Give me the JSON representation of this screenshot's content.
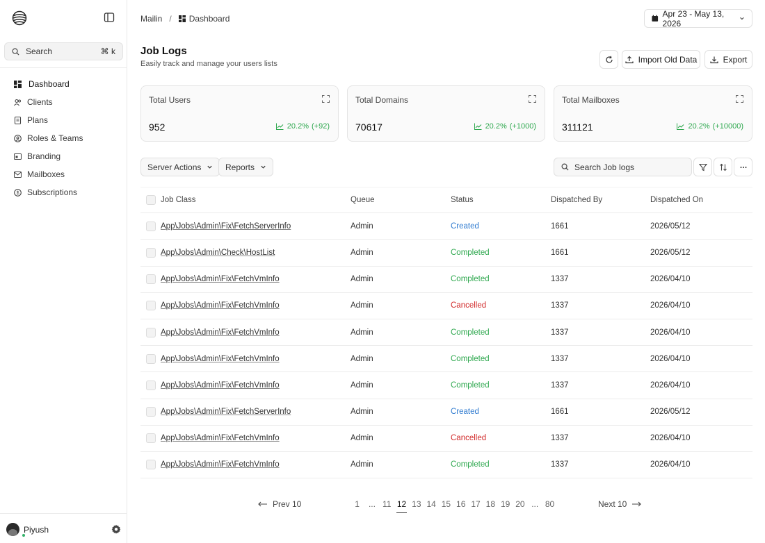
{
  "sidebar": {
    "search_label": "Search",
    "search_shortcut": "⌘ k",
    "items": [
      {
        "label": "Dashboard",
        "icon": "dashboard-icon"
      },
      {
        "label": "Clients",
        "icon": "users-icon"
      },
      {
        "label": "Plans",
        "icon": "document-icon"
      },
      {
        "label": "Roles & Teams",
        "icon": "roles-icon"
      },
      {
        "label": "Branding",
        "icon": "branding-icon"
      },
      {
        "label": "Mailboxes",
        "icon": "mail-icon"
      },
      {
        "label": "Subscriptions",
        "icon": "subscription-icon"
      }
    ],
    "user_name": "Piyush"
  },
  "header": {
    "breadcrumb_root": "Mailin",
    "breadcrumb_separator": "/",
    "breadcrumb_current": "Dashboard",
    "date_range": "Apr 23 - May 13, 2026"
  },
  "page": {
    "title": "Job Logs",
    "subtitle": "Easily track and manage your users lists",
    "import_label": "Import Old Data",
    "export_label": "Export"
  },
  "stats": [
    {
      "label": "Total Users",
      "value": "952",
      "trend_pct": "20.2%",
      "trend_delta": "(+92)"
    },
    {
      "label": "Total Domains",
      "value": "70617",
      "trend_pct": "20.2%",
      "trend_delta": "(+1000)"
    },
    {
      "label": "Total Mailboxes",
      "value": "311121",
      "trend_pct": "20.2%",
      "trend_delta": "(+10000)"
    }
  ],
  "filters": {
    "server_actions": "Server Actions",
    "reports": "Reports",
    "search_placeholder": "Search Job logs"
  },
  "table": {
    "columns": [
      "Job Class",
      "Queue",
      "Status",
      "Dispatched By",
      "Dispatched On"
    ],
    "rows": [
      {
        "job_class": "App\\Jobs\\Admin\\Fix\\FetchServerInfo",
        "queue": "Admin",
        "status": "Created",
        "by": "1661",
        "on": "2026/05/12"
      },
      {
        "job_class": "App\\Jobs\\Admin\\Check\\HostList",
        "queue": "Admin",
        "status": "Completed",
        "by": "1661",
        "on": "2026/05/12"
      },
      {
        "job_class": "App\\Jobs\\Admin\\Fix\\FetchVmInfo",
        "queue": "Admin",
        "status": "Completed",
        "by": "1337",
        "on": "2026/04/10"
      },
      {
        "job_class": "App\\Jobs\\Admin\\Fix\\FetchVmInfo",
        "queue": "Admin",
        "status": "Cancelled",
        "by": "1337",
        "on": "2026/04/10"
      },
      {
        "job_class": "App\\Jobs\\Admin\\Fix\\FetchVmInfo",
        "queue": "Admin",
        "status": "Completed",
        "by": "1337",
        "on": "2026/04/10"
      },
      {
        "job_class": "App\\Jobs\\Admin\\Fix\\FetchVmInfo",
        "queue": "Admin",
        "status": "Completed",
        "by": "1337",
        "on": "2026/04/10"
      },
      {
        "job_class": "App\\Jobs\\Admin\\Fix\\FetchVmInfo",
        "queue": "Admin",
        "status": "Completed",
        "by": "1337",
        "on": "2026/04/10"
      },
      {
        "job_class": "App\\Jobs\\Admin\\Fix\\FetchServerInfo",
        "queue": "Admin",
        "status": "Created",
        "by": "1661",
        "on": "2026/05/12"
      },
      {
        "job_class": "App\\Jobs\\Admin\\Fix\\FetchVmInfo",
        "queue": "Admin",
        "status": "Cancelled",
        "by": "1337",
        "on": "2026/04/10"
      },
      {
        "job_class": "App\\Jobs\\Admin\\Fix\\FetchVmInfo",
        "queue": "Admin",
        "status": "Completed",
        "by": "1337",
        "on": "2026/04/10"
      }
    ]
  },
  "pagination": {
    "prev_label": "Prev 10",
    "next_label": "Next 10",
    "pages": [
      "1",
      "...",
      "11",
      "12",
      "13",
      "14",
      "15",
      "16",
      "17",
      "18",
      "19",
      "20",
      "...",
      "80"
    ],
    "current": "12"
  },
  "colors": {
    "created": "#2f7bd0",
    "completed": "#2fa84f",
    "cancelled": "#d12a2a",
    "trend": "#2fa84f"
  }
}
